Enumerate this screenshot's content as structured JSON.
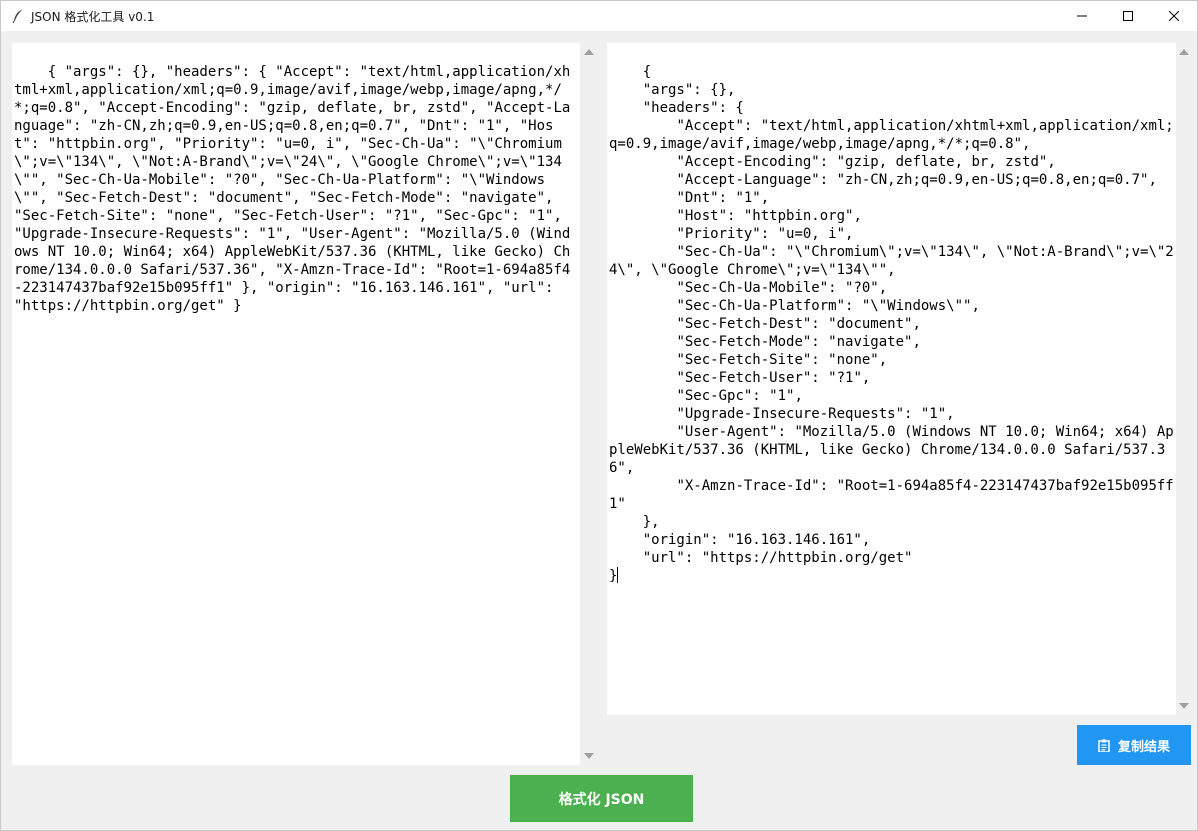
{
  "window": {
    "title": "JSON 格式化工具 v0.1",
    "icon": "feather-icon"
  },
  "input": {
    "text": "{ \"args\": {}, \"headers\": { \"Accept\": \"text/html,application/xhtml+xml,application/xml;q=0.9,image/avif,image/webp,image/apng,*/*;q=0.8\", \"Accept-Encoding\": \"gzip, deflate, br, zstd\", \"Accept-Language\": \"zh-CN,zh;q=0.9,en-US;q=0.8,en;q=0.7\", \"Dnt\": \"1\", \"Host\": \"httpbin.org\", \"Priority\": \"u=0, i\", \"Sec-Ch-Ua\": \"\\\"Chromium\\\";v=\\\"134\\\", \\\"Not:A-Brand\\\";v=\\\"24\\\", \\\"Google Chrome\\\";v=\\\"134\\\"\", \"Sec-Ch-Ua-Mobile\": \"?0\", \"Sec-Ch-Ua-Platform\": \"\\\"Windows\\\"\", \"Sec-Fetch-Dest\": \"document\", \"Sec-Fetch-Mode\": \"navigate\", \"Sec-Fetch-Site\": \"none\", \"Sec-Fetch-User\": \"?1\", \"Sec-Gpc\": \"1\", \"Upgrade-Insecure-Requests\": \"1\", \"User-Agent\": \"Mozilla/5.0 (Windows NT 10.0; Win64; x64) AppleWebKit/537.36 (KHTML, like Gecko) Chrome/134.0.0.0 Safari/537.36\", \"X-Amzn-Trace-Id\": \"Root=1-694a85f4-223147437baf92e15b095ff1\" }, \"origin\": \"16.163.146.161\", \"url\": \"https://httpbin.org/get\" }"
  },
  "output": {
    "text": "{\n    \"args\": {},\n    \"headers\": {\n        \"Accept\": \"text/html,application/xhtml+xml,application/xml;q=0.9,image/avif,image/webp,image/apng,*/*;q=0.8\",\n        \"Accept-Encoding\": \"gzip, deflate, br, zstd\",\n        \"Accept-Language\": \"zh-CN,zh;q=0.9,en-US;q=0.8,en;q=0.7\",\n        \"Dnt\": \"1\",\n        \"Host\": \"httpbin.org\",\n        \"Priority\": \"u=0, i\",\n        \"Sec-Ch-Ua\": \"\\\"Chromium\\\";v=\\\"134\\\", \\\"Not:A-Brand\\\";v=\\\"24\\\", \\\"Google Chrome\\\";v=\\\"134\\\"\",\n        \"Sec-Ch-Ua-Mobile\": \"?0\",\n        \"Sec-Ch-Ua-Platform\": \"\\\"Windows\\\"\",\n        \"Sec-Fetch-Dest\": \"document\",\n        \"Sec-Fetch-Mode\": \"navigate\",\n        \"Sec-Fetch-Site\": \"none\",\n        \"Sec-Fetch-User\": \"?1\",\n        \"Sec-Gpc\": \"1\",\n        \"Upgrade-Insecure-Requests\": \"1\",\n        \"User-Agent\": \"Mozilla/5.0 (Windows NT 10.0; Win64; x64) AppleWebKit/537.36 (KHTML, like Gecko) Chrome/134.0.0.0 Safari/537.36\",\n        \"X-Amzn-Trace-Id\": \"Root=1-694a85f4-223147437baf92e15b095ff1\"\n    },\n    \"origin\": \"16.163.146.161\",\n    \"url\": \"https://httpbin.org/get\"\n}"
  },
  "buttons": {
    "copy_label": "复制结果",
    "copy_icon": "clipboard-icon",
    "format_label": "格式化 JSON"
  },
  "colors": {
    "copy_button": "#2196f3",
    "format_button": "#4caf50",
    "background": "#f0f0f0"
  }
}
